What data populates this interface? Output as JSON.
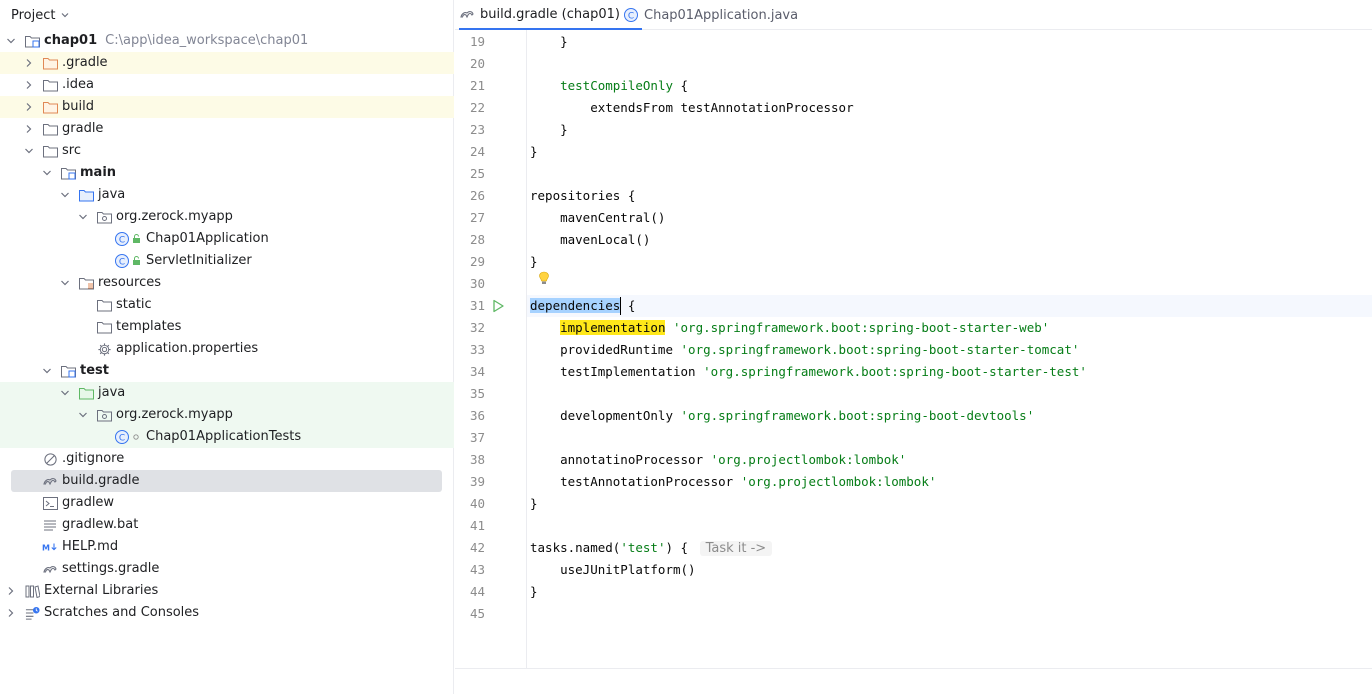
{
  "project_panel": {
    "title": "Project",
    "tree": [
      {
        "label": "chap01",
        "path": "C:\\app\\idea_workspace\\chap01",
        "icon": "module-folder-icon",
        "bold": true,
        "depth": 0,
        "arrow": "down",
        "bg": "none"
      },
      {
        "label": ".gradle",
        "icon": "folder-orange-icon",
        "depth": 1,
        "arrow": "right",
        "bg": "yellow"
      },
      {
        "label": ".idea",
        "icon": "folder-icon",
        "depth": 1,
        "arrow": "right",
        "bg": "none"
      },
      {
        "label": "build",
        "icon": "folder-orange-icon",
        "depth": 1,
        "arrow": "right",
        "bg": "yellow"
      },
      {
        "label": "gradle",
        "icon": "folder-icon",
        "depth": 1,
        "arrow": "right",
        "bg": "none"
      },
      {
        "label": "src",
        "icon": "folder-icon",
        "depth": 1,
        "arrow": "down",
        "bg": "none"
      },
      {
        "label": "main",
        "icon": "module-folder-icon",
        "bold": true,
        "depth": 2,
        "arrow": "down",
        "bg": "none"
      },
      {
        "label": "java",
        "icon": "source-folder-icon",
        "depth": 3,
        "arrow": "down",
        "bg": "none"
      },
      {
        "label": "org.zerock.myapp",
        "icon": "package-icon",
        "depth": 4,
        "arrow": "down",
        "bg": "none"
      },
      {
        "label": "Chap01Application",
        "icon": "class-icon",
        "depth": 5,
        "arrow": "none",
        "bg": "none"
      },
      {
        "label": "ServletInitializer",
        "icon": "class-icon",
        "depth": 5,
        "arrow": "none",
        "bg": "none"
      },
      {
        "label": "resources",
        "icon": "resources-folder-icon",
        "depth": 3,
        "arrow": "down",
        "bg": "none"
      },
      {
        "label": "static",
        "icon": "folder-icon",
        "depth": 4,
        "arrow": "none",
        "bg": "none"
      },
      {
        "label": "templates",
        "icon": "folder-icon",
        "depth": 4,
        "arrow": "none",
        "bg": "none"
      },
      {
        "label": "application.properties",
        "icon": "gear-icon",
        "depth": 4,
        "arrow": "none",
        "bg": "none"
      },
      {
        "label": "test",
        "icon": "module-folder-icon",
        "bold": true,
        "depth": 2,
        "arrow": "down",
        "bg": "none"
      },
      {
        "label": "java",
        "icon": "test-folder-icon",
        "depth": 3,
        "arrow": "down",
        "bg": "green"
      },
      {
        "label": "org.zerock.myapp",
        "icon": "package-icon",
        "depth": 4,
        "arrow": "down",
        "bg": "green"
      },
      {
        "label": "Chap01ApplicationTests",
        "icon": "class-icon",
        "depth": 5,
        "arrow": "none",
        "bg": "green"
      },
      {
        "label": ".gitignore",
        "icon": "ignore-icon",
        "depth": 1,
        "arrow": "none",
        "bg": "none"
      },
      {
        "label": "build.gradle",
        "icon": "gradle-icon",
        "depth": 1,
        "arrow": "none",
        "bg": "selected"
      },
      {
        "label": "gradlew",
        "icon": "terminal-icon",
        "depth": 1,
        "arrow": "none",
        "bg": "none"
      },
      {
        "label": "gradlew.bat",
        "icon": "text-file-icon",
        "depth": 1,
        "arrow": "none",
        "bg": "none"
      },
      {
        "label": "HELP.md",
        "icon": "markdown-icon",
        "depth": 1,
        "arrow": "none",
        "bg": "none"
      },
      {
        "label": "settings.gradle",
        "icon": "gradle-icon",
        "depth": 1,
        "arrow": "none",
        "bg": "none"
      },
      {
        "label": "External Libraries",
        "icon": "library-icon",
        "depth": 0,
        "arrow": "right",
        "bg": "none"
      },
      {
        "label": "Scratches and Consoles",
        "icon": "scratches-icon",
        "depth": 0,
        "arrow": "right",
        "bg": "none"
      }
    ]
  },
  "tabs": [
    {
      "label": "build.gradle (chap01)",
      "icon": "gradle-icon",
      "active": true,
      "close": "×"
    },
    {
      "label": "Chap01Application.java",
      "icon": "class-icon",
      "active": false
    }
  ],
  "editor": {
    "current_line": 31,
    "lines": [
      {
        "n": 19,
        "parts": [
          {
            "t": "    }"
          }
        ]
      },
      {
        "n": 20,
        "parts": []
      },
      {
        "n": 21,
        "parts": [
          {
            "t": "    "
          },
          {
            "t": "testCompileOnly",
            "c": "kw-green"
          },
          {
            "t": " {"
          }
        ]
      },
      {
        "n": 22,
        "parts": [
          {
            "t": "        extendsFrom testAnnotationProcessor"
          }
        ]
      },
      {
        "n": 23,
        "parts": [
          {
            "t": "    }"
          }
        ]
      },
      {
        "n": 24,
        "parts": [
          {
            "t": "}"
          }
        ]
      },
      {
        "n": 25,
        "parts": []
      },
      {
        "n": 26,
        "parts": [
          {
            "t": "repositories {"
          }
        ]
      },
      {
        "n": 27,
        "parts": [
          {
            "t": "    mavenCentral()"
          }
        ]
      },
      {
        "n": 28,
        "parts": [
          {
            "t": "    mavenLocal()"
          }
        ]
      },
      {
        "n": 29,
        "parts": [
          {
            "t": "}"
          }
        ]
      },
      {
        "n": 30,
        "parts": []
      },
      {
        "n": 31,
        "parts": [
          {
            "t": "dependencies",
            "c": "sel"
          },
          {
            "t": " {"
          }
        ]
      },
      {
        "n": 32,
        "parts": [
          {
            "t": "    "
          },
          {
            "t": "implementation",
            "c": "hl-yellow"
          },
          {
            "t": " "
          },
          {
            "t": "'org.springframework.boot:spring-boot-starter-web'",
            "c": "str"
          }
        ]
      },
      {
        "n": 33,
        "parts": [
          {
            "t": "    providedRuntime "
          },
          {
            "t": "'org.springframework.boot:spring-boot-starter-tomcat'",
            "c": "str"
          }
        ]
      },
      {
        "n": 34,
        "parts": [
          {
            "t": "    testImplementation "
          },
          {
            "t": "'org.springframework.boot:spring-boot-starter-test'",
            "c": "str"
          }
        ]
      },
      {
        "n": 35,
        "parts": []
      },
      {
        "n": 36,
        "parts": [
          {
            "t": "    developmentOnly "
          },
          {
            "t": "'org.springframework.boot:spring-boot-devtools'",
            "c": "str"
          }
        ]
      },
      {
        "n": 37,
        "parts": []
      },
      {
        "n": 38,
        "parts": [
          {
            "t": "    annotatinoProcessor "
          },
          {
            "t": "'org.projectlombok:lombok'",
            "c": "str"
          }
        ]
      },
      {
        "n": 39,
        "parts": [
          {
            "t": "    testAnnotationProcessor "
          },
          {
            "t": "'org.projectlombok:lombok'",
            "c": "str"
          }
        ]
      },
      {
        "n": 40,
        "parts": [
          {
            "t": "}"
          }
        ]
      },
      {
        "n": 41,
        "parts": []
      },
      {
        "n": 42,
        "parts": [
          {
            "t": "tasks.named("
          },
          {
            "t": "'test'",
            "c": "str"
          },
          {
            "t": ") { "
          },
          {
            "t": "Task it ->",
            "c": "hint"
          }
        ]
      },
      {
        "n": 43,
        "parts": [
          {
            "t": "    useJUnitPlatform()"
          }
        ]
      },
      {
        "n": 44,
        "parts": [
          {
            "t": "}"
          }
        ]
      },
      {
        "n": 45,
        "parts": []
      }
    ],
    "gutter_icons": [
      {
        "line": 30,
        "icon": "lightbulb-icon"
      },
      {
        "line": 31,
        "icon": "run-icon"
      }
    ]
  }
}
